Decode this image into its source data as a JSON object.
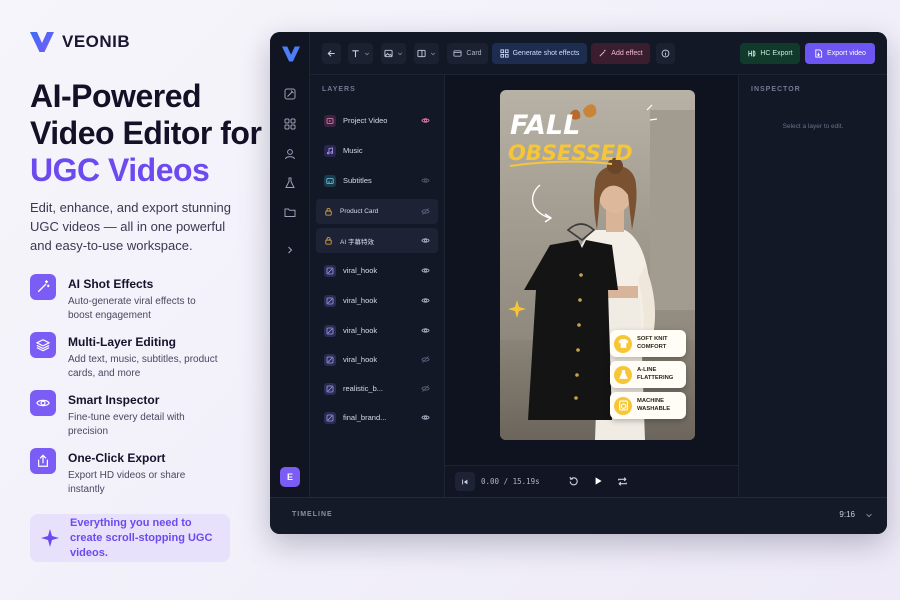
{
  "brand": {
    "name": "VEONIB"
  },
  "hero": {
    "line1": "AI-Powered",
    "line2": "Video Editor for",
    "line3": "UGC Videos",
    "subcopy": "Edit, enhance, and export stunning UGC videos — all in one powerful and easy-to-use workspace."
  },
  "features": [
    {
      "icon": "magic-wand-icon",
      "title": "AI Shot Effects",
      "desc": "Auto-generate viral effects to boost engagement"
    },
    {
      "icon": "layers-icon",
      "title": "Multi-Layer Editing",
      "desc": "Add text, music, subtitles, product cards, and more"
    },
    {
      "icon": "eye-icon",
      "title": "Smart Inspector",
      "desc": "Fine-tune every detail with precision"
    },
    {
      "icon": "export-icon",
      "title": "One-Click Export",
      "desc": "Export HD videos or share instantly"
    }
  ],
  "cta": {
    "text": "Everything you need to create scroll-stopping UGC videos."
  },
  "toolbar": {
    "card": "Card",
    "generate": "Generate shot effects",
    "add_effect": "Add effect",
    "hd_export": "HC Export",
    "export_video": "Export video"
  },
  "layers": {
    "title": "LAYERS",
    "items": [
      {
        "name": "Project Video",
        "icon": "video-icon"
      },
      {
        "name": "Music",
        "icon": "music-icon"
      },
      {
        "name": "Subtitles",
        "icon": "subtitles-icon"
      },
      {
        "name": "Product Card",
        "icon": "lock-icon"
      },
      {
        "name": "AI 字幕特效",
        "icon": "lock-icon"
      },
      {
        "name": "viral_hook",
        "icon": "clip-icon"
      },
      {
        "name": "viral_hook",
        "icon": "clip-icon"
      },
      {
        "name": "viral_hook",
        "icon": "clip-icon"
      },
      {
        "name": "viral_hook",
        "icon": "clip-icon"
      },
      {
        "name": "realistic_b...",
        "icon": "clip-icon"
      },
      {
        "name": "final_brand...",
        "icon": "clip-icon"
      }
    ]
  },
  "video": {
    "headline1": "FALL",
    "headline2": "OBSESSED",
    "badges": [
      {
        "line1": "SOFT KNIT",
        "line2": "COMFORT"
      },
      {
        "line1": "A-LINE",
        "line2": "FLATTERING"
      },
      {
        "line1": "MACHINE",
        "line2": "WASHABLE"
      }
    ]
  },
  "transport": {
    "time": "0.00 / 15.19s"
  },
  "inspector": {
    "title": "INSPECTOR",
    "empty": "Select a layer to edit."
  },
  "timeline": {
    "label": "TIMELINE",
    "ratio": "9:16"
  },
  "rail": {
    "avatar": "E"
  },
  "colors": {
    "accent": "#6d4af0",
    "app_bg": "#121624",
    "badge_yellow": "#f6c636"
  }
}
